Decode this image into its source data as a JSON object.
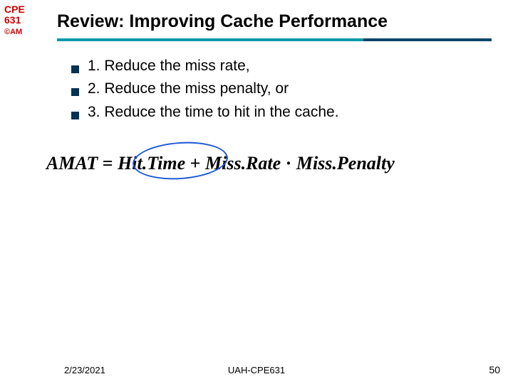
{
  "sidebar": {
    "course_line1": "CPE",
    "course_line2": "631",
    "am": "©AM"
  },
  "title": "Review: Improving Cache Performance",
  "bullets": [
    "1. Reduce the miss rate,",
    "2. Reduce the miss penalty, or",
    "3. Reduce the time to hit in the cache."
  ],
  "formula": {
    "lhs": "AMAT",
    "eq": "=",
    "hit": "Hit.Time",
    "plus": "+",
    "missrate": "Miss.Rate",
    "dot": "·",
    "misspenalty": "Miss.Penalty"
  },
  "footer": {
    "date": "2/23/2021",
    "center": "UAH-CPE631",
    "page": "50"
  }
}
